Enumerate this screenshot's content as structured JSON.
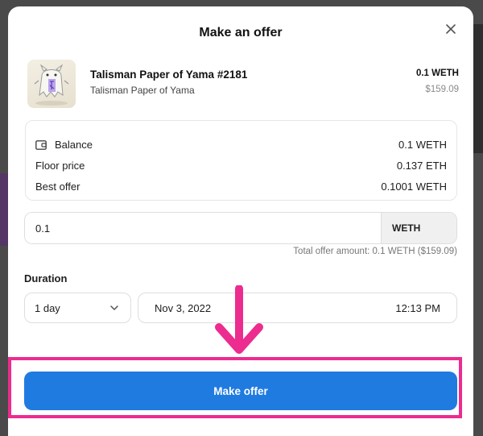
{
  "modal": {
    "title": "Make an offer",
    "close_icon": "close-icon"
  },
  "nft": {
    "name": "Talisman Paper of Yama #2181",
    "collection": "Talisman Paper of Yama",
    "price": "0.1 WETH",
    "price_usd": "$159.09",
    "thumbnail_icon": "talisman-ghost-image"
  },
  "stats": [
    {
      "label": "Balance",
      "value": "0.1 WETH",
      "icon": "wallet-icon"
    },
    {
      "label": "Floor price",
      "value": "0.137 ETH"
    },
    {
      "label": "Best offer",
      "value": "0.1001 WETH"
    }
  ],
  "offer": {
    "amount_value": "0.1",
    "currency": "WETH",
    "total_text": "Total offer amount: 0.1 WETH ($159.09)"
  },
  "duration": {
    "label": "Duration",
    "selected": "1 day",
    "date": "Nov 3, 2022",
    "time": "12:13 PM"
  },
  "annotation": {
    "arrow_color": "#ec2c8f",
    "highlight_color": "#ec2c8f"
  },
  "actions": {
    "make_offer_label": "Make offer",
    "button_color": "#1f7be0"
  }
}
